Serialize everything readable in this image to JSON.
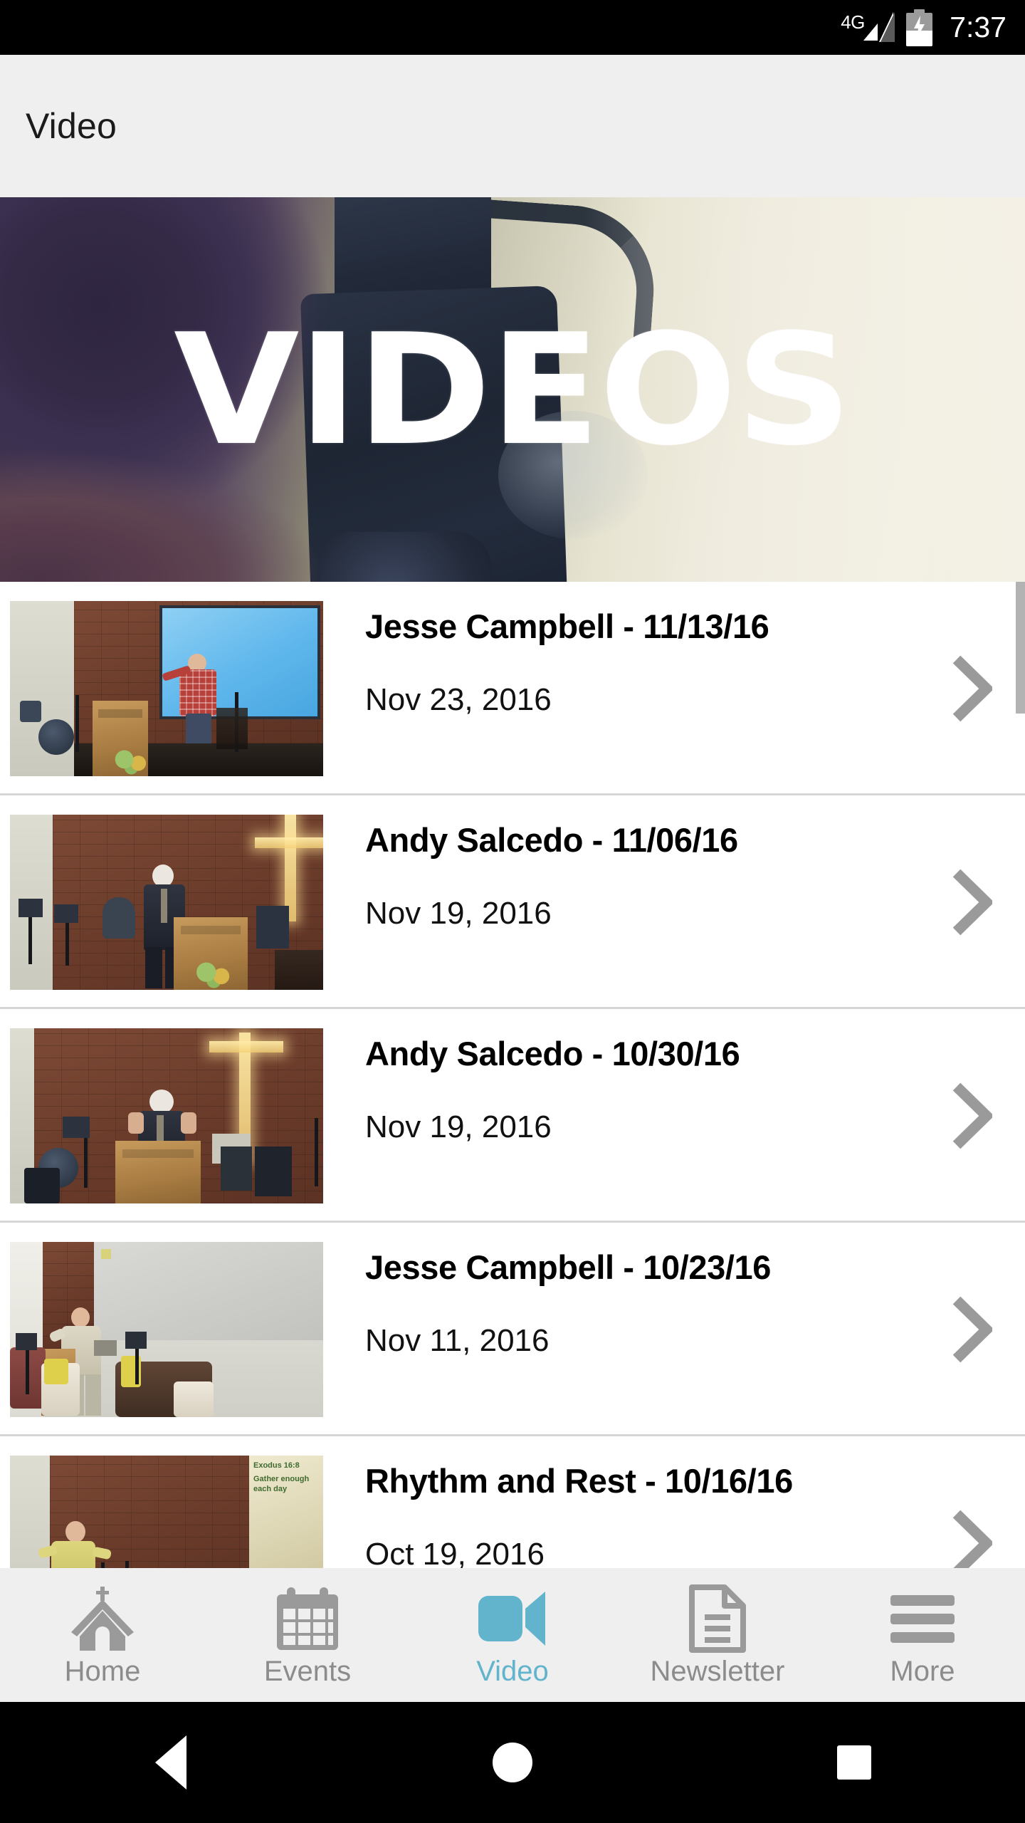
{
  "statusbar": {
    "network_label": "4G",
    "time": "7:37",
    "signal_icon": "signal-bars-icon",
    "battery_icon": "battery-charging-icon"
  },
  "appbar": {
    "title": "Video"
  },
  "hero": {
    "headline": "VIDEOS",
    "image_description": "video camera on tripod filming over a person's shoulder"
  },
  "list": {
    "items": [
      {
        "title": "Jesse Campbell - 11/13/16",
        "date": "Nov 23, 2016",
        "chevron": "chevron-right-icon"
      },
      {
        "title": "Andy Salcedo - 11/06/16",
        "date": "Nov 19, 2016",
        "chevron": "chevron-right-icon"
      },
      {
        "title": "Andy Salcedo - 10/30/16",
        "date": "Nov 19, 2016",
        "chevron": "chevron-right-icon"
      },
      {
        "title": "Jesse Campbell - 10/23/16",
        "date": "Nov 11, 2016",
        "chevron": "chevron-right-icon"
      },
      {
        "title": "Rhythm and Rest - 10/16/16",
        "date": "Oct 19, 2016",
        "chevron": "chevron-right-icon"
      }
    ],
    "slide_overlay": {
      "line1": "Exodus 16:8",
      "line2": "Gather enough",
      "line3": "each day"
    }
  },
  "tabbar": {
    "active_color": "#62b4cd",
    "inactive_color": "#8c8c8c",
    "items": [
      {
        "label": "Home",
        "icon": "church-icon",
        "active": false
      },
      {
        "label": "Events",
        "icon": "calendar-icon",
        "active": false
      },
      {
        "label": "Video",
        "icon": "video-camera-icon",
        "active": true
      },
      {
        "label": "Newsletter",
        "icon": "document-icon",
        "active": false
      },
      {
        "label": "More",
        "icon": "hamburger-icon",
        "active": false
      }
    ]
  },
  "navbar": {
    "back": "back-triangle-icon",
    "home": "home-circle-icon",
    "recents": "recents-square-icon"
  }
}
